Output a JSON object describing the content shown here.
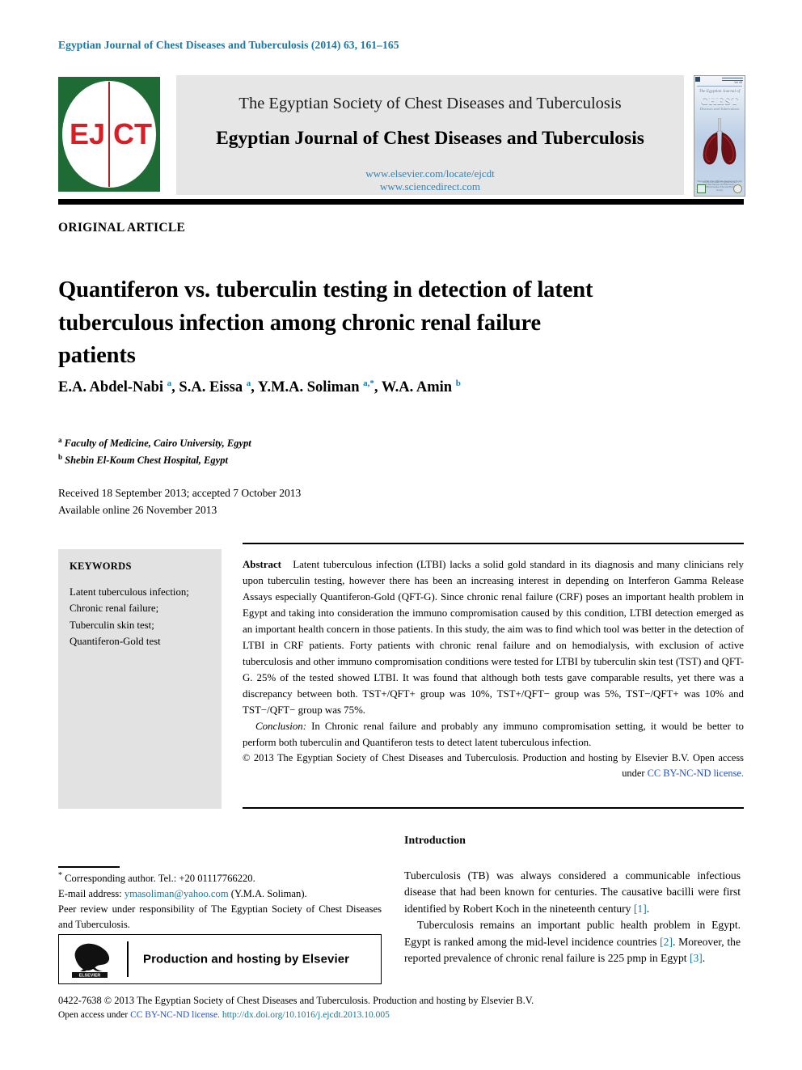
{
  "running_head": "Egyptian Journal of Chest Diseases and Tuberculosis (2014) 63, 161–165",
  "masthead": {
    "logo_text_left": "EJ",
    "logo_text_right": "CT",
    "society": "The Egyptian Society of Chest Diseases and Tuberculosis",
    "journal": "Egyptian Journal of Chest Diseases and Tuberculosis",
    "link_elsevier": "www.elsevier.com/locate/ejcdt",
    "link_sciencedirect": "www.sciencedirect.com",
    "cover": {
      "line1": "The Egyptian Journal of",
      "line2": "CHEST",
      "line3": "Diseases and Tuberculosis",
      "volume": "Vol. 63",
      "bottom_italic": "Since 1952 The Official Journal of Egypt",
      "bottom_small": "The Official Journal of Egyptian Society of Chest Diseases and Tuberculosis\nAn Official Journal of the Arab Thoracic Society"
    }
  },
  "article": {
    "category": "ORIGINAL ARTICLE",
    "title": "Quantiferon vs. tuberculin testing in detection of latent tuberculous infection among chronic renal failure patients",
    "authors": [
      {
        "name": "E.A. Abdel-Nabi",
        "marks": "a",
        "sep": ", "
      },
      {
        "name": "S.A. Eissa",
        "marks": "a",
        "sep": ", "
      },
      {
        "name": "Y.M.A. Soliman",
        "marks": "a,*",
        "sep": ", "
      },
      {
        "name": "W.A. Amin",
        "marks": "b",
        "sep": ""
      }
    ],
    "affiliations": [
      {
        "mark": "a",
        "text": "Faculty of Medicine, Cairo University, Egypt"
      },
      {
        "mark": "b",
        "text": "Shebin El-Koum Chest Hospital, Egypt"
      }
    ],
    "received": "Received 18 September 2013; accepted 7 October 2013",
    "available": "Available online 26 November 2013"
  },
  "keywords": {
    "heading": "KEYWORDS",
    "items": [
      "Latent tuberculous infection;",
      "Chronic renal failure;",
      "Tuberculin skin test;",
      "Quantiferon-Gold test"
    ]
  },
  "abstract": {
    "label": "Abstract",
    "body": "Latent tuberculous infection (LTBI) lacks a solid gold standard in its diagnosis and many clinicians rely upon tuberculin testing, however there has been an increasing interest in depending on Interferon Gamma Release Assays especially Quantiferon-Gold (QFT-G). Since chronic renal failure (CRF) poses an important health problem in Egypt and taking into consideration the immuno compromisation caused by this condition, LTBI detection emerged as an important health concern in those patients. In this study, the aim was to find which tool was better in the detection of LTBI in CRF patients. Forty patients with chronic renal failure and on hemodialysis, with exclusion of active tuberculosis and other immuno compromisation conditions were tested for LTBI by tuberculin skin test (TST) and QFT-G. 25% of the tested showed LTBI. It was found that although both tests gave comparable results, yet there was a discrepancy between both. TST+/QFT+ group was 10%, TST+/QFT− group was 5%, TST−/QFT+ was 10% and TST−/QFT− group was 75%.",
    "conclusion_label": "Conclusion:",
    "conclusion_body": "In Chronic renal failure and probably any immuno compromisation setting, it would be better to perform both tuberculin and Quantiferon tests to detect latent tuberculous infection.",
    "copyright": "© 2013 The Egyptian Society of Chest Diseases and Tuberculosis. Production and hosting by Elsevier B.V. Open access under",
    "license_link": "CC BY-NC-ND license."
  },
  "footnotes": {
    "corresponding_mark": "*",
    "corresponding": "Corresponding author. Tel.: +20 01117766220.",
    "email_label": "E-mail address:",
    "email": "ymasoliman@yahoo.com",
    "email_owner": "(Y.M.A. Soliman).",
    "peer_review": "Peer review under responsibility of The Egyptian Society of Chest Diseases and Tuberculosis.",
    "elsevier_box": "Production and hosting by Elsevier",
    "elsevier_wordmark": "ELSEVIER"
  },
  "bottom_legal": {
    "line1": "0422-7638 © 2013 The Egyptian Society of Chest Diseases and Tuberculosis. Production and hosting by Elsevier B.V.",
    "line2_prefix": "Open access under",
    "line2_license": "CC BY-NC-ND license.",
    "line2_doi": "http://dx.doi.org/10.1016/j.ejcdt.2013.10.005"
  },
  "introduction": {
    "heading": "Introduction",
    "para1_a": "Tuberculosis (TB) was always considered a communicable infectious disease that had been known for centuries. The causative bacilli were first identified by Robert Koch in the nineteenth century ",
    "para1_ref": "[1]",
    "para1_b": ".",
    "para2_a": "Tuberculosis remains an important public health problem in Egypt. Egypt is ranked among the mid-level incidence countries ",
    "para2_ref1": "[2]",
    "para2_b": ". Moreover, the reported prevalence of chronic renal failure is 225 pmp in Egypt ",
    "para2_ref2": "[3]",
    "para2_c": "."
  },
  "colors": {
    "running_head": "#1878a8",
    "link_blue": "#2e84b8",
    "license_blue": "#1f4fd8",
    "doi_teal": "#0f7a9c",
    "logo_green": "#1e6b35",
    "logo_red": "#d81f26",
    "banner_gray": "#e6e6e6",
    "keywords_gray": "#e2e2e2"
  }
}
